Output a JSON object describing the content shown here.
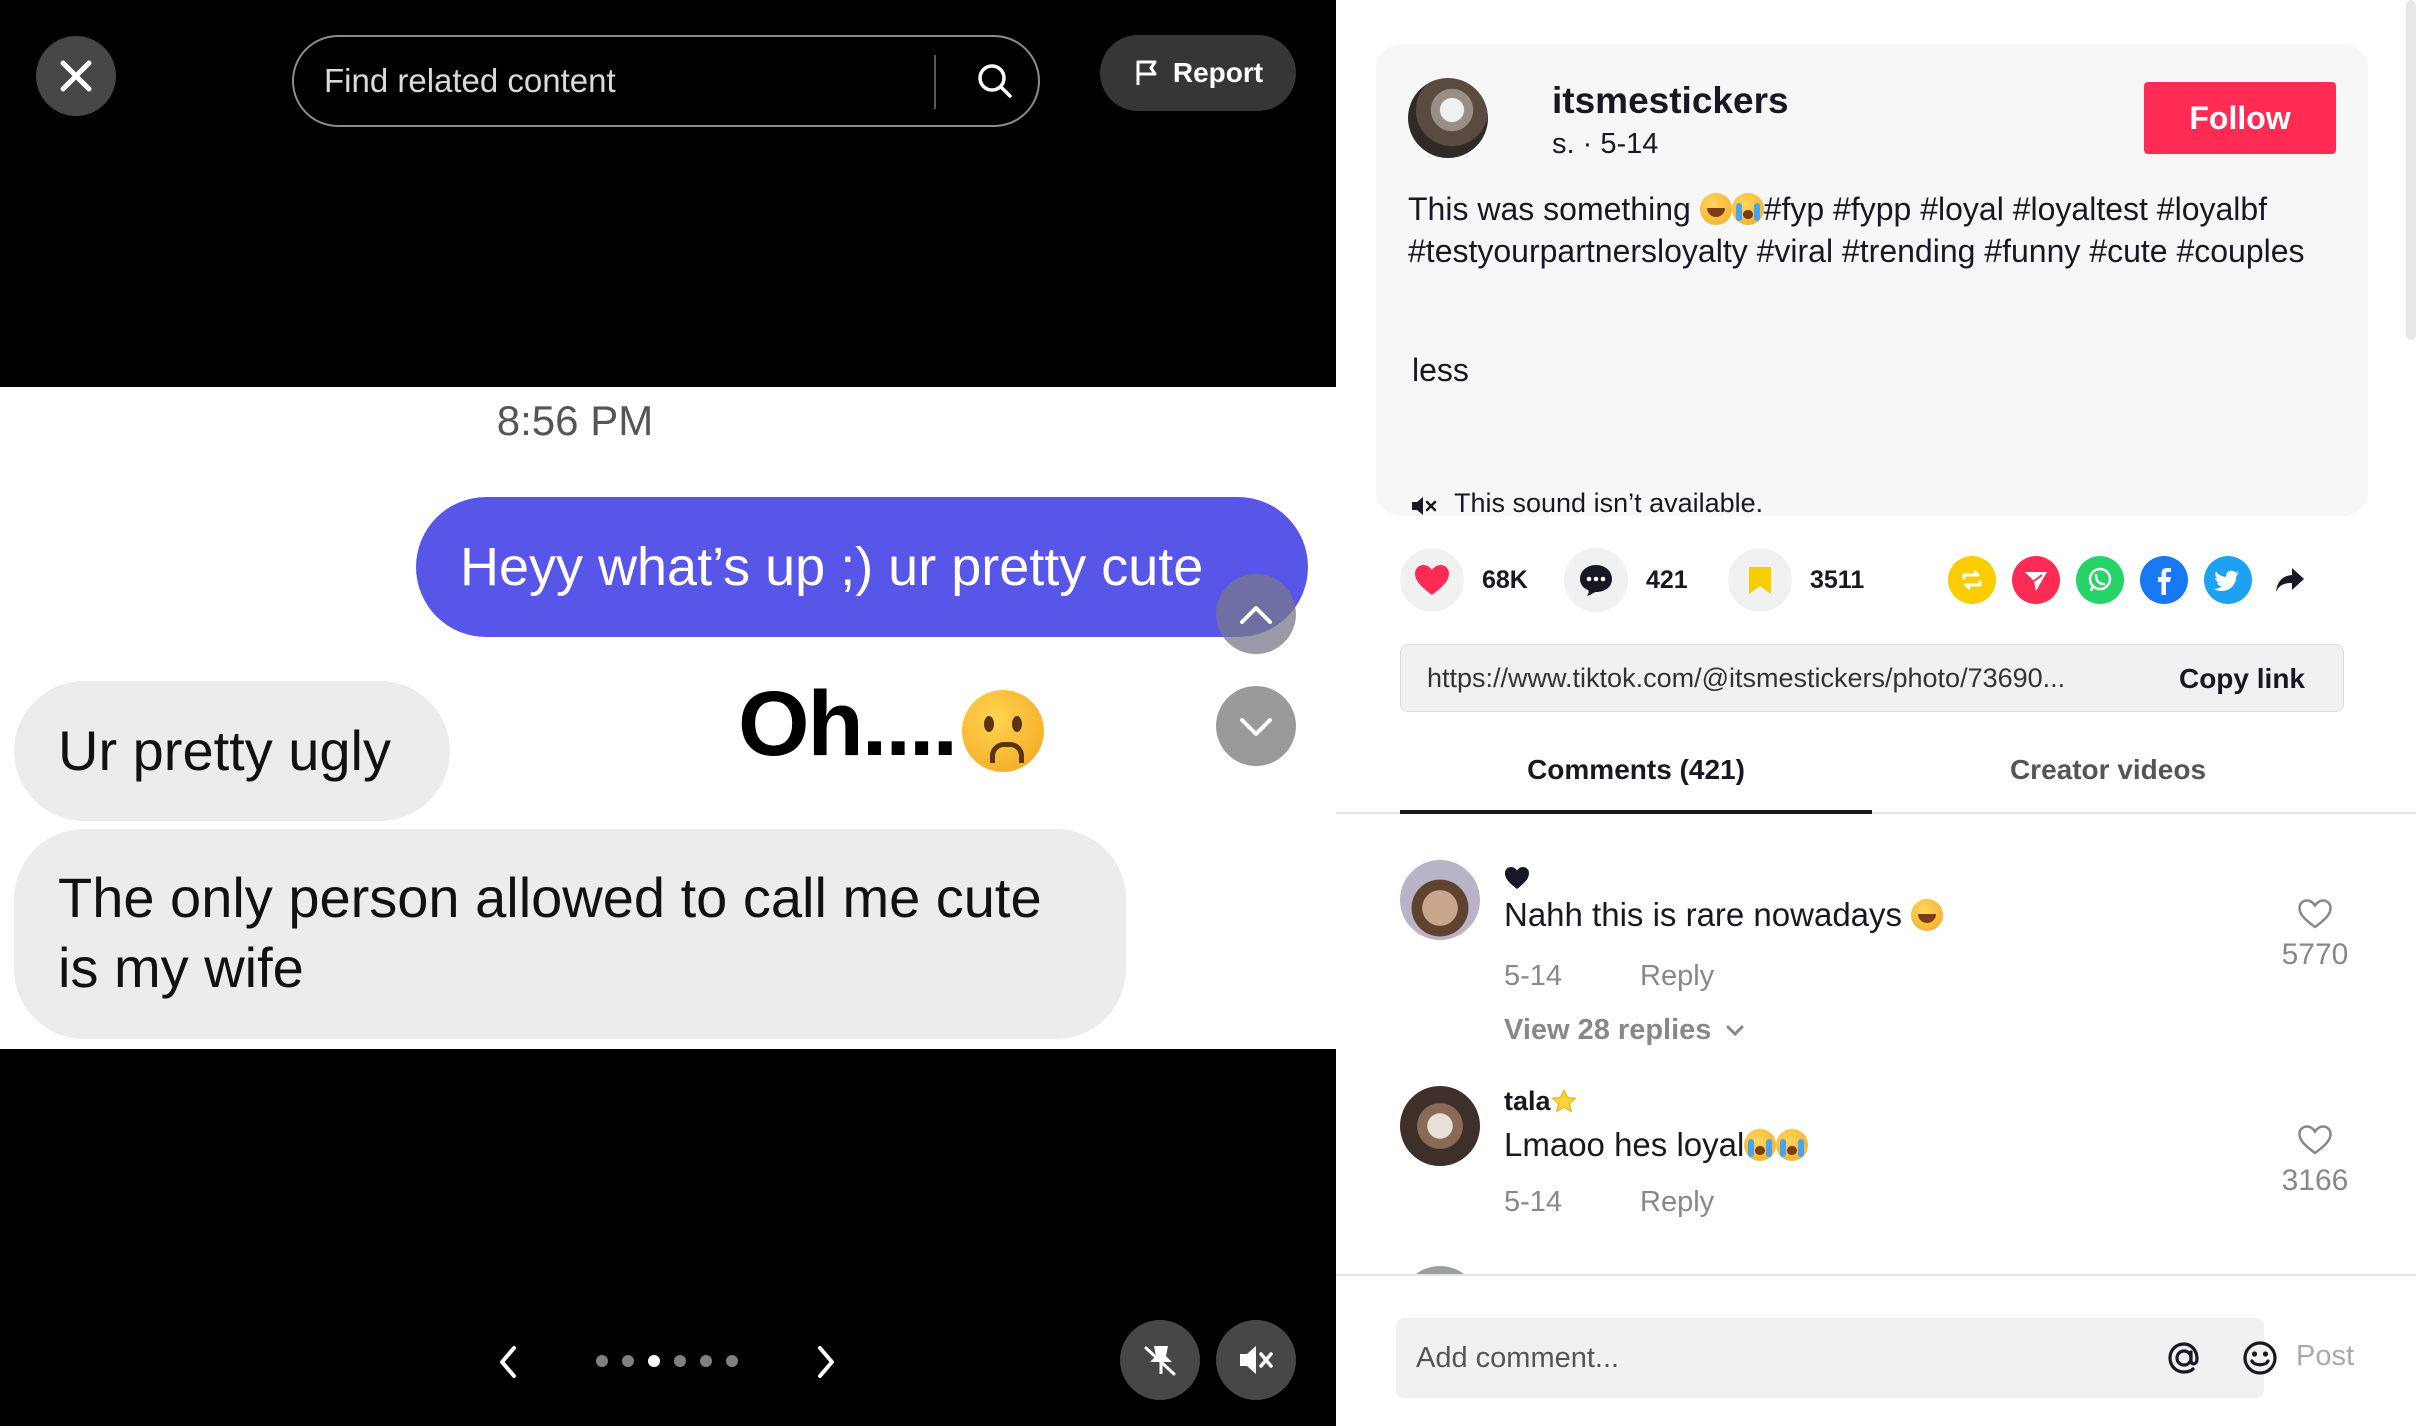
{
  "media": {
    "close_icon": "close-icon",
    "search": {
      "placeholder": "Find related content",
      "icon": "search-icon"
    },
    "report_label": "Report",
    "photo": {
      "timestamp": "8:56 PM",
      "outgoing_message": "Heyy what’s up ;) ur pretty cute",
      "incoming_message_1": "Ur pretty ugly",
      "incoming_message_2": "The only person allowed to call me cute is my wife",
      "overlay_text": "Oh....",
      "accent_color": "#5856e8"
    },
    "carousel": {
      "total": 6,
      "active_index": 2
    }
  },
  "post": {
    "username": "itsmestickers",
    "subline": "s. · 5-14",
    "follow_label": "Follow",
    "caption_text": "This was something",
    "caption_tags": "#fyp #fypp #loyal #loyaltest #loyalbf #testyourpartnersloyalty #viral #trending #funny #cute #couples",
    "less_label": "less",
    "sound_text": "This sound isn’t available.",
    "brand_color": "#fe2c55"
  },
  "actions": {
    "likes": "68K",
    "comments": "421",
    "saves": "3511"
  },
  "share": {
    "url": "https://www.tiktok.com/@itsmestickers/photo/73690...",
    "copy_label": "Copy link"
  },
  "tabs": {
    "comments": "Comments (421)",
    "creator": "Creator videos"
  },
  "comments": [
    {
      "name": "",
      "text": "Nahh this is rare nowadays",
      "date": "5-14",
      "reply": "Reply",
      "likes": "5770",
      "view_replies": "View 28 replies"
    },
    {
      "name": "tala",
      "text": "Lmaoo hes loyal",
      "date": "5-14",
      "reply": "Reply",
      "likes": "3166"
    }
  ],
  "composer": {
    "placeholder": "Add comment...",
    "post_label": "Post"
  }
}
